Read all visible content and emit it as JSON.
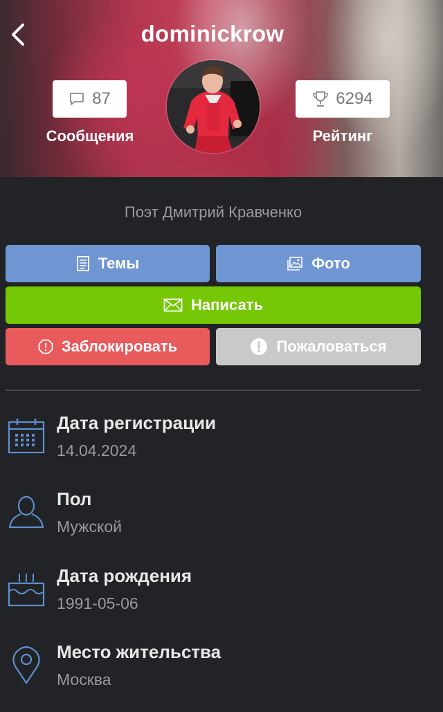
{
  "profile": {
    "username": "dominickrow",
    "status": "Поэт Дмитрий Кравченко"
  },
  "stats": {
    "messages": {
      "value": "87",
      "label": "Сообщения",
      "icon": "speech-bubble-icon"
    },
    "rating": {
      "value": "6294",
      "label": "Рейтинг",
      "icon": "trophy-icon"
    }
  },
  "actions": {
    "topics": "Темы",
    "photo": "Фото",
    "write": "Написать",
    "block": "Заблокировать",
    "report": "Пожаловаться"
  },
  "info": {
    "registration": {
      "title": "Дата регистрации",
      "value": "14.04.2024",
      "icon": "calendar-icon"
    },
    "gender": {
      "title": "Пол",
      "value": "Мужской",
      "icon": "user-icon"
    },
    "birthday": {
      "title": "Дата рождения",
      "value": "1991-05-06",
      "icon": "cake-icon"
    },
    "city": {
      "title": "Место жительства",
      "value": "Москва",
      "icon": "location-pin-icon"
    }
  },
  "colors": {
    "background": "#222326",
    "button_blue": "#6f95d3",
    "button_green": "#76c706",
    "button_red": "#e85a5c",
    "button_gray": "#c9c9c9",
    "icon_blue": "#5f8fd0"
  }
}
